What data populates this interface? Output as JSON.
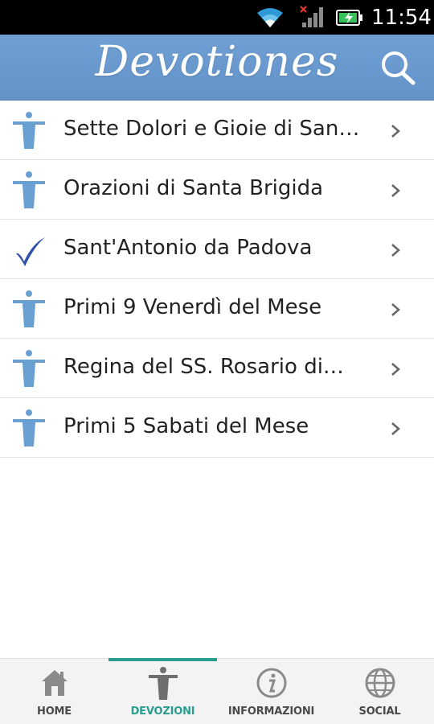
{
  "status_bar": {
    "time": "11:54",
    "icons": [
      "wifi-icon",
      "signal-no-service-icon",
      "battery-charging-icon"
    ]
  },
  "header": {
    "title": "Devotiones",
    "search_icon": "search-icon",
    "background_color": "#6a9ad0"
  },
  "devotions": [
    {
      "label": "Sette Dolori e Gioie di San…",
      "icon": "christ-statue-icon",
      "done": false
    },
    {
      "label": "Orazioni di Santa Brigida",
      "icon": "christ-statue-icon",
      "done": false
    },
    {
      "label": "Sant'Antonio da Padova",
      "icon": "checkmark-icon",
      "done": true
    },
    {
      "label": "Primi 9 Venerdì del Mese",
      "icon": "christ-statue-icon",
      "done": false
    },
    {
      "label": "Regina del SS. Rosario di…",
      "icon": "christ-statue-icon",
      "done": false
    },
    {
      "label": "Primi 5 Sabati del Mese",
      "icon": "christ-statue-icon",
      "done": false
    }
  ],
  "bottom_nav": {
    "active": "DEVOZIONI",
    "accent_color": "#2a9d8f",
    "tabs": [
      {
        "label": "HOME",
        "icon": "home-icon"
      },
      {
        "label": "DEVOZIONI",
        "icon": "christ-statue-icon"
      },
      {
        "label": "INFORMAZIONI",
        "icon": "info-icon"
      },
      {
        "label": "SOCIAL",
        "icon": "globe-icon"
      }
    ]
  }
}
